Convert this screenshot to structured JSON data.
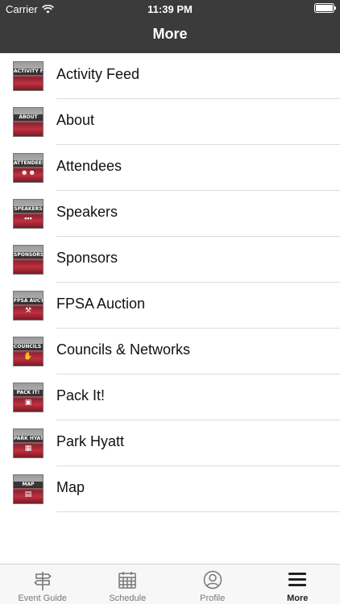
{
  "status": {
    "carrier": "Carrier",
    "time": "11:39 PM"
  },
  "nav": {
    "title": "More"
  },
  "items": [
    {
      "label": "Activity Feed",
      "thumb": "ACTIVITY FEED",
      "icon": "activity-feed-icon"
    },
    {
      "label": "About",
      "thumb": "ABOUT",
      "icon": "about-icon"
    },
    {
      "label": "Attendees",
      "thumb": "ATTENDEES",
      "icon": "attendees-icon"
    },
    {
      "label": "Speakers",
      "thumb": "SPEAKERS",
      "icon": "speakers-icon"
    },
    {
      "label": "Sponsors",
      "thumb": "SPONSORS",
      "icon": "sponsors-icon"
    },
    {
      "label": "FPSA Auction",
      "thumb": "FPSA AUCTION",
      "icon": "auction-icon"
    },
    {
      "label": "Councils & Networks",
      "thumb": "COUNCILS & NETWORKS",
      "icon": "councils-icon"
    },
    {
      "label": "Pack It!",
      "thumb": "PACK IT!",
      "icon": "pack-it-icon"
    },
    {
      "label": "Park Hyatt",
      "thumb": "PARK HYATT",
      "icon": "park-hyatt-icon"
    },
    {
      "label": "Map",
      "thumb": "MAP",
      "icon": "map-icon"
    }
  ],
  "tabs": [
    {
      "label": "Event Guide",
      "icon": "signpost-icon",
      "active": false
    },
    {
      "label": "Schedule",
      "icon": "calendar-icon",
      "active": false
    },
    {
      "label": "Profile",
      "icon": "profile-icon",
      "active": false
    },
    {
      "label": "More",
      "icon": "menu-icon",
      "active": true
    }
  ]
}
